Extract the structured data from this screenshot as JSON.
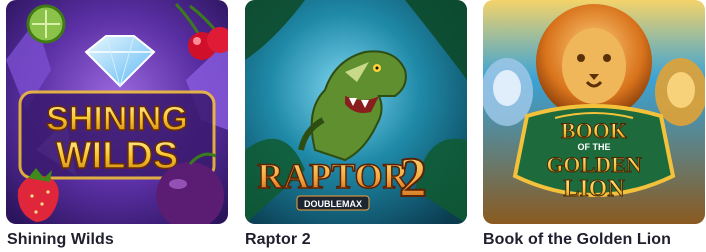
{
  "games": [
    {
      "title": "Shining Wilds",
      "art_text": [
        "SHINING",
        "WILDS"
      ],
      "icons": [
        "diamond-icon",
        "lime-icon",
        "cherries-icon",
        "strawberry-icon",
        "plum-icon"
      ],
      "colors": {
        "bg": "#4b2a8a",
        "accent": "#f7c531",
        "crystal": "#8fd3ff"
      }
    },
    {
      "title": "Raptor 2",
      "art_text": [
        "RAPTOR",
        "2",
        "DOUBLEMAX"
      ],
      "icons": [
        "raptor-icon"
      ],
      "colors": {
        "bg": "#0e5a73",
        "accent": "#f2a13b",
        "dino": "#5f8f2e"
      }
    },
    {
      "title": "Book of the Golden Lion",
      "art_text": [
        "BOOK",
        "OF THE",
        "GOLDEN",
        "LION"
      ],
      "icons": [
        "lion-icon",
        "tiger-icon",
        "book-icon"
      ],
      "colors": {
        "bg": "#3aa3d6",
        "accent": "#f4c23a",
        "emblem": "#1d6b3c"
      }
    }
  ]
}
